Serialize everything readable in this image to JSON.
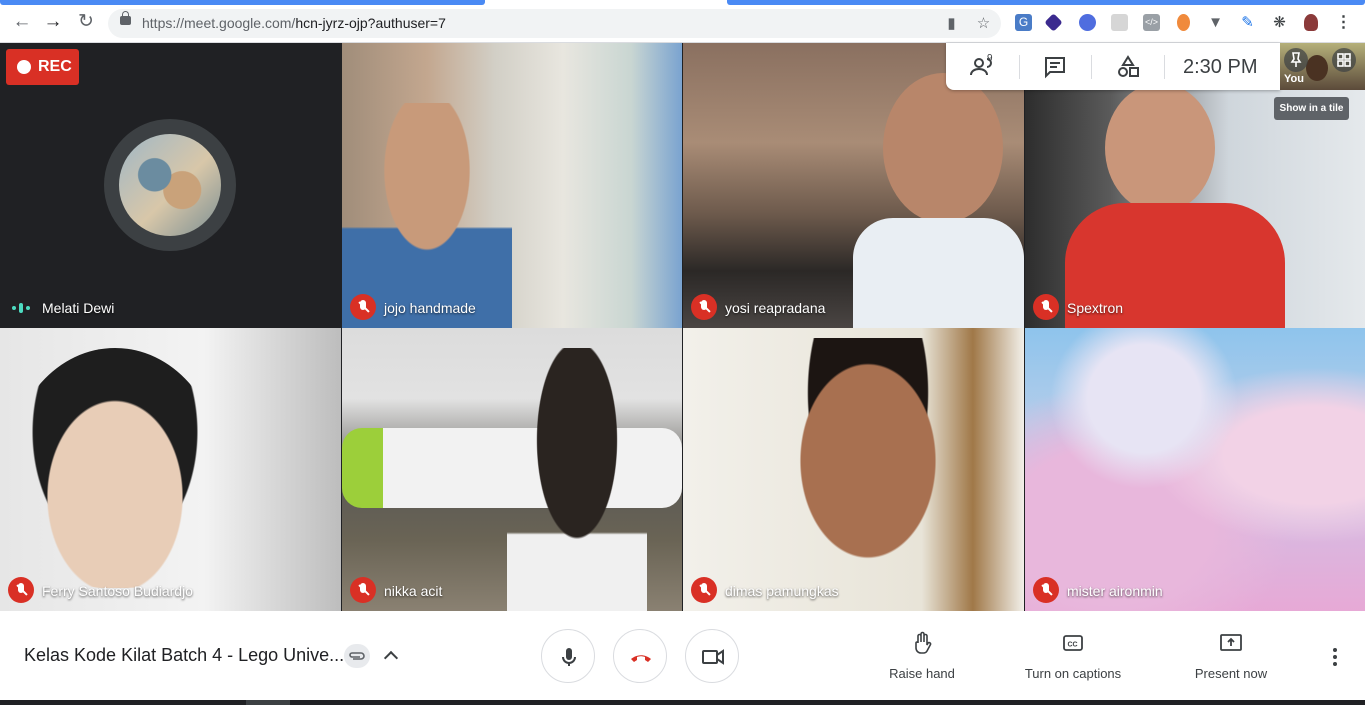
{
  "browser": {
    "url_host": "https://meet.google.com/",
    "url_path": "hcn-jyrz-ojp?authuser=7"
  },
  "recording": {
    "label": "REC"
  },
  "participants": [
    {
      "name": "Melati Dewi"
    },
    {
      "name": "jojo handmade"
    },
    {
      "name": "yosi reapradana"
    },
    {
      "name": "Spextron"
    },
    {
      "name": "Ferry Santoso Budiardjo"
    },
    {
      "name": "nikka acit"
    },
    {
      "name": "dimas pamungkas"
    },
    {
      "name": "mister aironmin"
    }
  ],
  "top_panel": {
    "participant_count": "9",
    "time": "2:30  PM"
  },
  "self_view": {
    "label": "You"
  },
  "tooltip": "Show in a tile",
  "bottom_bar": {
    "meeting_title": "Kelas Kode Kilat Batch 4 - Lego Unive...",
    "raise_hand": "Raise hand",
    "captions": "Turn on captions",
    "present": "Present now"
  },
  "colors": {
    "accent_red": "#d93025",
    "talking": "#4ddbc1",
    "blue": "#1a73e8"
  }
}
